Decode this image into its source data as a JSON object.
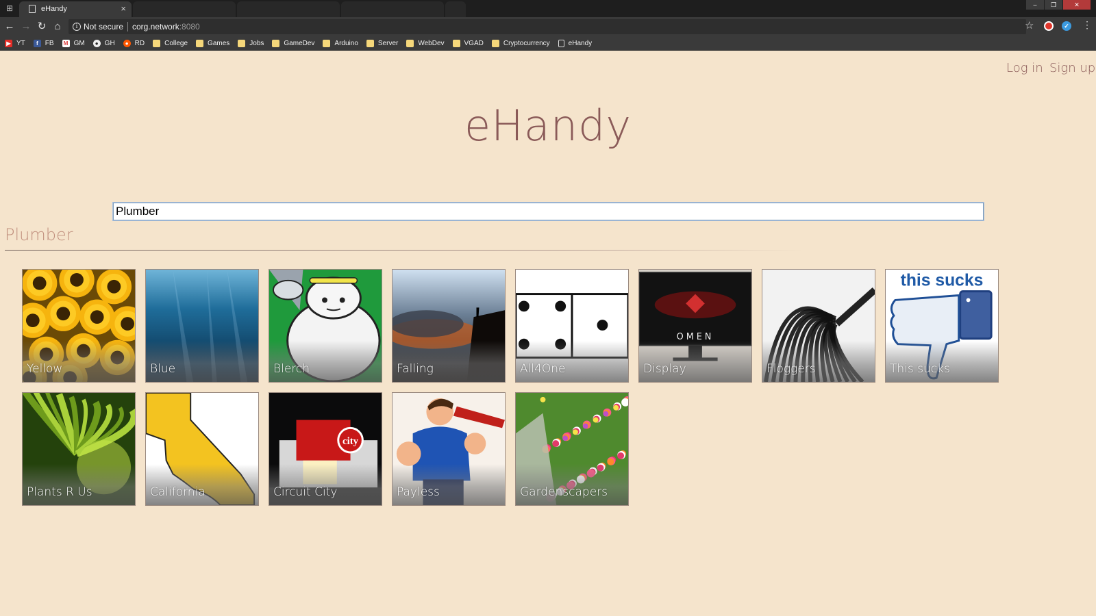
{
  "browser": {
    "tab_title": "eHandy",
    "security_label": "Not secure",
    "url_host": "corg.network",
    "url_port": ":8080",
    "bookmarks": [
      {
        "label": "YT",
        "icon": "youtube-icon"
      },
      {
        "label": "FB",
        "icon": "facebook-icon"
      },
      {
        "label": "GM",
        "icon": "gmail-icon"
      },
      {
        "label": "GH",
        "icon": "github-icon"
      },
      {
        "label": "RD",
        "icon": "reddit-icon"
      },
      {
        "label": "College",
        "icon": "folder-icon"
      },
      {
        "label": "Games",
        "icon": "folder-icon"
      },
      {
        "label": "Jobs",
        "icon": "folder-icon"
      },
      {
        "label": "GameDev",
        "icon": "folder-icon"
      },
      {
        "label": "Arduino",
        "icon": "folder-icon"
      },
      {
        "label": "Server",
        "icon": "folder-icon"
      },
      {
        "label": "WebDev",
        "icon": "folder-icon"
      },
      {
        "label": "VGAD",
        "icon": "folder-icon"
      },
      {
        "label": "Cryptocurrency",
        "icon": "folder-icon"
      },
      {
        "label": "eHandy",
        "icon": "page-icon"
      }
    ]
  },
  "header": {
    "login_label": "Log in",
    "signup_label": "Sign up",
    "site_title": "eHandy"
  },
  "search": {
    "value": "Plumber"
  },
  "results": {
    "heading": "Plumber",
    "tiles": [
      {
        "label": "Yellow",
        "art": "sunflowers"
      },
      {
        "label": "Blue",
        "art": "ocean"
      },
      {
        "label": "Blerch",
        "art": "blerch"
      },
      {
        "label": "Falling",
        "art": "smoke-cliff"
      },
      {
        "label": "All4One",
        "art": "dice"
      },
      {
        "label": "Display",
        "art": "monitor"
      },
      {
        "label": "Floggers",
        "art": "floggers"
      },
      {
        "label": "This sucks",
        "art": "thumbs-down"
      },
      {
        "label": "Plants R Us",
        "art": "palm"
      },
      {
        "label": "California",
        "art": "california"
      },
      {
        "label": "Circuit City",
        "art": "store"
      },
      {
        "label": "Payless",
        "art": "plumber"
      },
      {
        "label": "Gardenscapers",
        "art": "garden"
      }
    ]
  },
  "tile_art_text": {
    "monitor_brand": "OMEN",
    "store_sign": "city",
    "thumbs_caption": "this sucks"
  },
  "colors": {
    "page_bg": "#f5e4cc",
    "accent_text": "#8a5a58"
  }
}
